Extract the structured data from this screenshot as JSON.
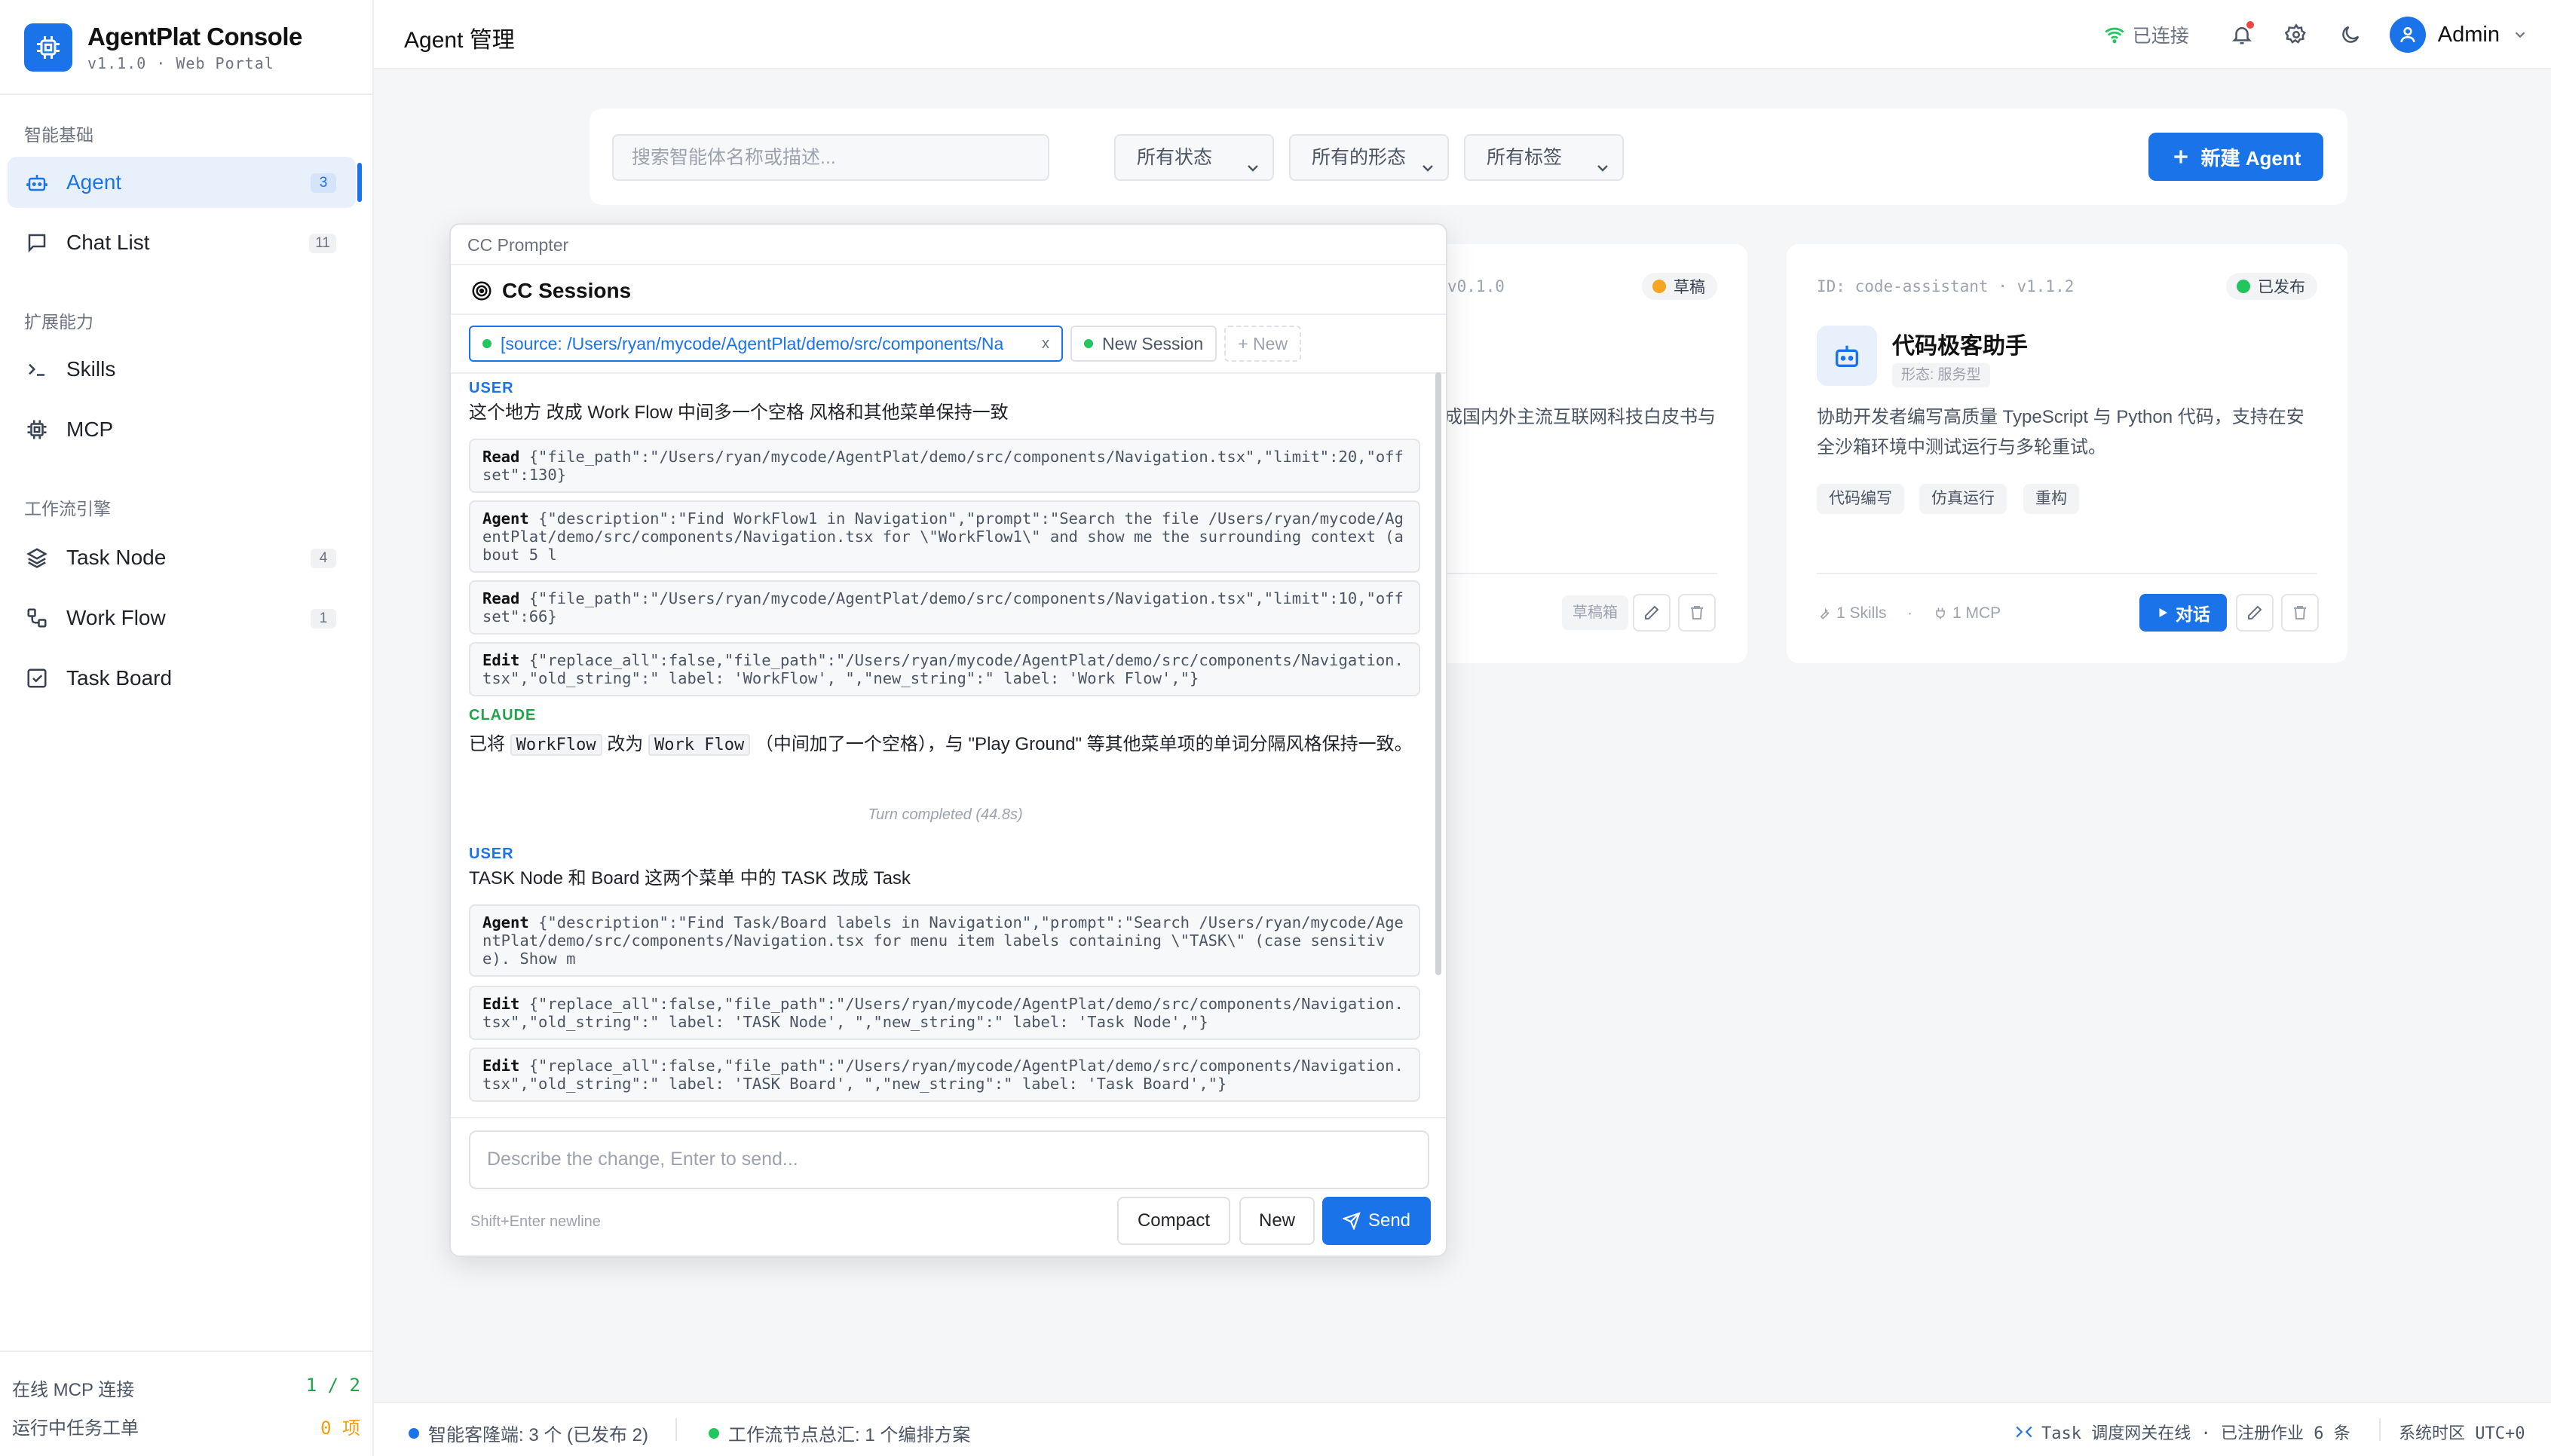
{
  "brand": {
    "title": "AgentPlat Console",
    "subtitle": "v1.1.0 · Web Portal"
  },
  "sidebar": {
    "sections": [
      {
        "label": "智能基础"
      },
      {
        "label": "扩展能力"
      },
      {
        "label": "工作流引擎"
      }
    ],
    "items": [
      {
        "label": "Agent",
        "badge": "3",
        "icon": "robot-icon",
        "active": true
      },
      {
        "label": "Chat List",
        "badge": "11",
        "icon": "chat-icon"
      },
      {
        "label": "Skills",
        "badge": "",
        "icon": "terminal-icon"
      },
      {
        "label": "MCP",
        "badge": "",
        "icon": "chip-icon"
      },
      {
        "label": "Task Node",
        "badge": "4",
        "icon": "layers-icon"
      },
      {
        "label": "Work Flow",
        "badge": "1",
        "icon": "workflow-icon"
      },
      {
        "label": "Task Board",
        "badge": "",
        "icon": "checkbox-icon"
      }
    ],
    "footer": {
      "mcp_label": "在线 MCP 连接",
      "mcp_value": "1 / 2",
      "tasks_label": "运行中任务工单",
      "tasks_value": "0 项"
    }
  },
  "header": {
    "title": "Agent 管理",
    "status": "已连接",
    "user": "Admin"
  },
  "toolbar": {
    "search_placeholder": "搜索智能体名称或描述...",
    "filters": [
      "所有状态",
      "所有的形态",
      "所有标签"
    ],
    "new_button": "新建 Agent"
  },
  "cards": [
    {
      "id_text": "v0.1.0",
      "status": "草稿",
      "status_color": "#f5a623",
      "desc": "成国内外主流互联网科技白皮书与",
      "btn": "草稿箱"
    },
    {
      "id_text": "ID: code-assistant · v1.1.2",
      "status": "已发布",
      "status_color": "#22c55e",
      "name": "代码极客助手",
      "form": "形态: 服务型",
      "desc": "协助开发者编写高质量 TypeScript 与 Python 代码，支持在安全沙箱环境中测试运行与多轮重试。",
      "tags": [
        "代码编写",
        "仿真运行",
        "重构"
      ],
      "skills": "1 Skills",
      "mcp": "1 MCP",
      "chat": "对话"
    }
  ],
  "statusbar": {
    "left1": "智能客隆端: 3 个 (已发布 2)",
    "left2": "工作流节点总汇: 1 个编排方案",
    "right1": "Task 调度网关在线 · 已注册作业 6 条",
    "right2": "系统时区 UTC+0"
  },
  "prompter": {
    "title": "CC Prompter",
    "heading": "CC Sessions",
    "tabs": {
      "active": "[source: /Users/ryan/mycode/AgentPlat/demo/src/components/Na",
      "close": "x",
      "new_session": "New Session",
      "new": "+ New"
    },
    "messages": {
      "user_role": "USER",
      "claude_role": "CLAUDE",
      "u1": "这个地方 改成 Work Flow 中间多一个空格 风格和其他菜单保持一致",
      "t1_name": "Read",
      "t1_args": "{\"file_path\":\"/Users/ryan/mycode/AgentPlat/demo/src/components/Navigation.tsx\",\"limit\":20,\"offset\":130}",
      "t2_name": "Agent",
      "t2_args": "{\"description\":\"Find WorkFlow1 in Navigation\",\"prompt\":\"Search the file /Users/ryan/mycode/AgentPlat/demo/src/components/Navigation.tsx for \\\"WorkFlow1\\\" and show me the surrounding context (about 5 l",
      "t3_name": "Read",
      "t3_args": "{\"file_path\":\"/Users/ryan/mycode/AgentPlat/demo/src/components/Navigation.tsx\",\"limit\":10,\"offset\":66}",
      "t4_name": "Edit",
      "t4_args": "{\"replace_all\":false,\"file_path\":\"/Users/ryan/mycode/AgentPlat/demo/src/components/Navigation.tsx\",\"old_string\":\" label: 'WorkFlow', \",\"new_string\":\" label: 'Work Flow',\"}",
      "c1_a": "已将",
      "c1_code1": "WorkFlow",
      "c1_b": "改为",
      "c1_code2": "Work Flow",
      "c1_c": "（中间加了一个空格），与 \"Play Ground\" 等其他菜单项的单词分隔风格保持一致。",
      "turn": "Turn completed (44.8s)",
      "u2": "TASK Node 和  Board 这两个菜单 中的 TASK  改成 Task",
      "t5_name": "Agent",
      "t5_args": "{\"description\":\"Find Task/Board labels in Navigation\",\"prompt\":\"Search /Users/ryan/mycode/AgentPlat/demo/src/components/Navigation.tsx for menu item labels containing \\\"TASK\\\" (case sensitive). Show m",
      "t6_name": "Edit",
      "t6_args": "{\"replace_all\":false,\"file_path\":\"/Users/ryan/mycode/AgentPlat/demo/src/components/Navigation.tsx\",\"old_string\":\" label: 'TASK Node', \",\"new_string\":\" label: 'Task Node',\"}",
      "t7_name": "Edit",
      "t7_args": "{\"replace_all\":false,\"file_path\":\"/Users/ryan/mycode/AgentPlat/demo/src/components/Navigation.tsx\",\"old_string\":\" label: 'TASK Board', \",\"new_string\":\" label: 'Task Board',\"}"
    },
    "input_placeholder": "Describe the change, Enter to send...",
    "hint": "Shift+Enter newline",
    "compact": "Compact",
    "new": "New",
    "send": "Send"
  }
}
